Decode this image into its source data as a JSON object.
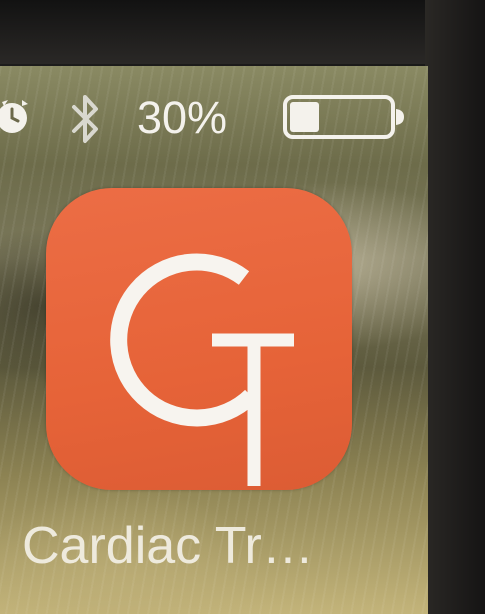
{
  "status_bar": {
    "alarm_icon": "alarm-clock-icon",
    "bluetooth_icon": "bluetooth-icon",
    "battery_percent": "30%",
    "battery_level": 0.3,
    "battery_icon": "battery-icon"
  },
  "app": {
    "label": "Cardiac Tr…",
    "icon_letters": "CT",
    "icon_color": "#e8673c"
  },
  "colors": {
    "status_text": "#f4f2ec",
    "label_text": "#eeeadd",
    "glyph": "#f7f4ef"
  }
}
